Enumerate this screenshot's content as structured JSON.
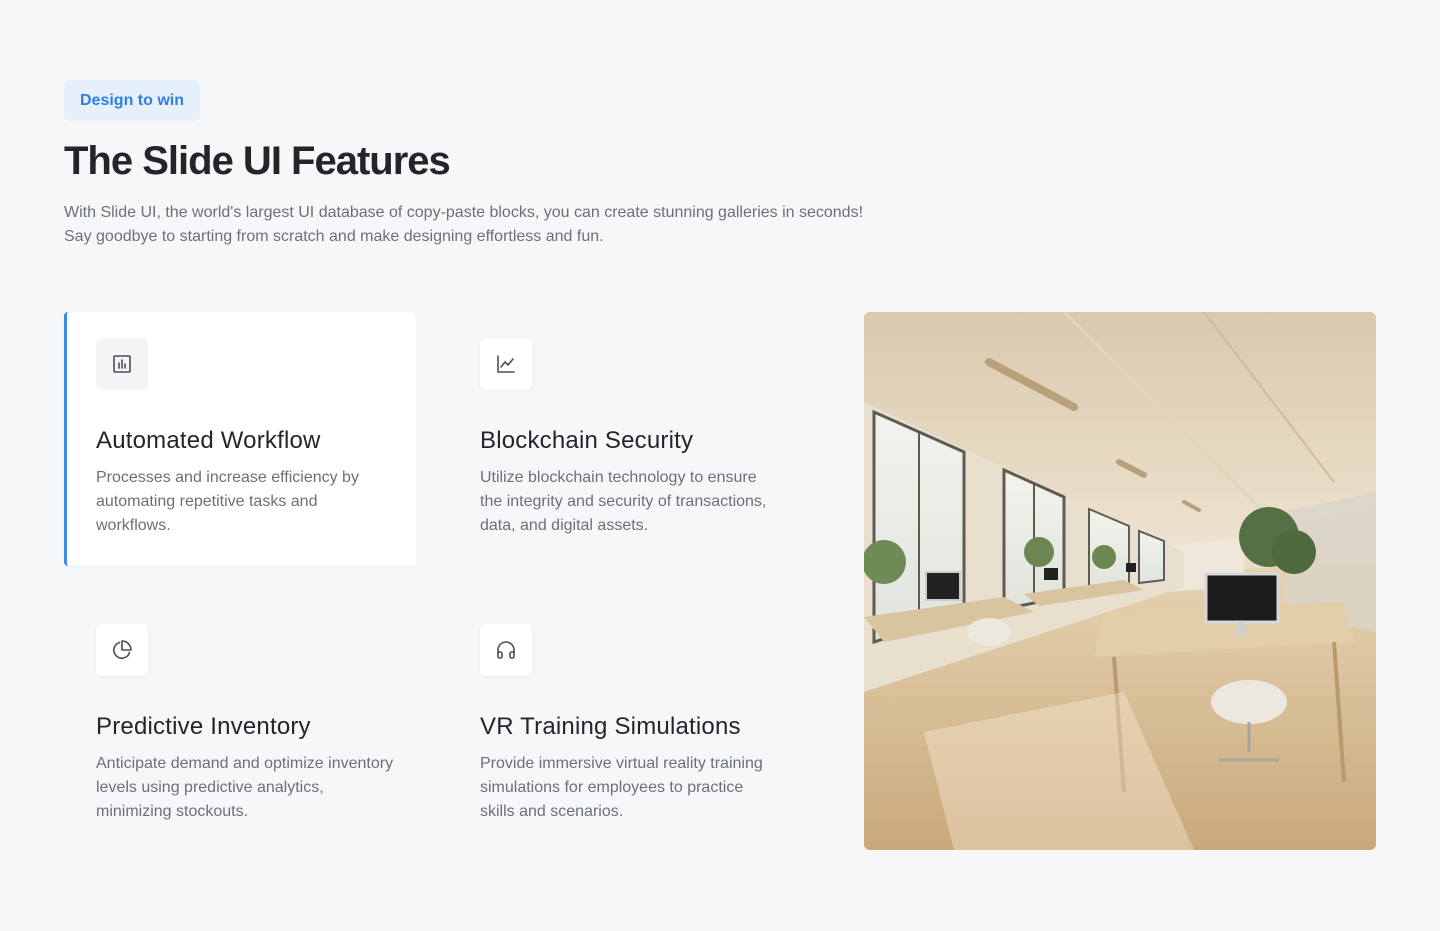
{
  "badge": "Design to win",
  "heading": "The Slide UI Features",
  "intro": "With Slide UI, the world's largest UI database of copy-paste blocks, you can create stunning galleries in seconds! Say goodbye to starting from scratch and make designing effortless and fun.",
  "features": [
    {
      "icon": "bar-chart-icon",
      "title": "Automated Workflow",
      "description": "Processes and increase efficiency by automating repetitive tasks and workflows.",
      "active": true
    },
    {
      "icon": "line-chart-icon",
      "title": "Blockchain Security",
      "description": "Utilize blockchain technology to ensure the integrity and security of transactions, data, and digital assets.",
      "active": false
    },
    {
      "icon": "pie-chart-icon",
      "title": "Predictive Inventory",
      "description": "Anticipate demand and optimize inventory levels using predictive analytics, minimizing stockouts.",
      "active": false
    },
    {
      "icon": "headphones-icon",
      "title": "VR Training Simulations",
      "description": "Provide immersive virtual reality training simulations for employees to practice skills and scenarios.",
      "active": false
    }
  ],
  "colors": {
    "accent": "#2f7fe0",
    "active_border": "#3d8ae8",
    "background": "#f6f7f9"
  }
}
